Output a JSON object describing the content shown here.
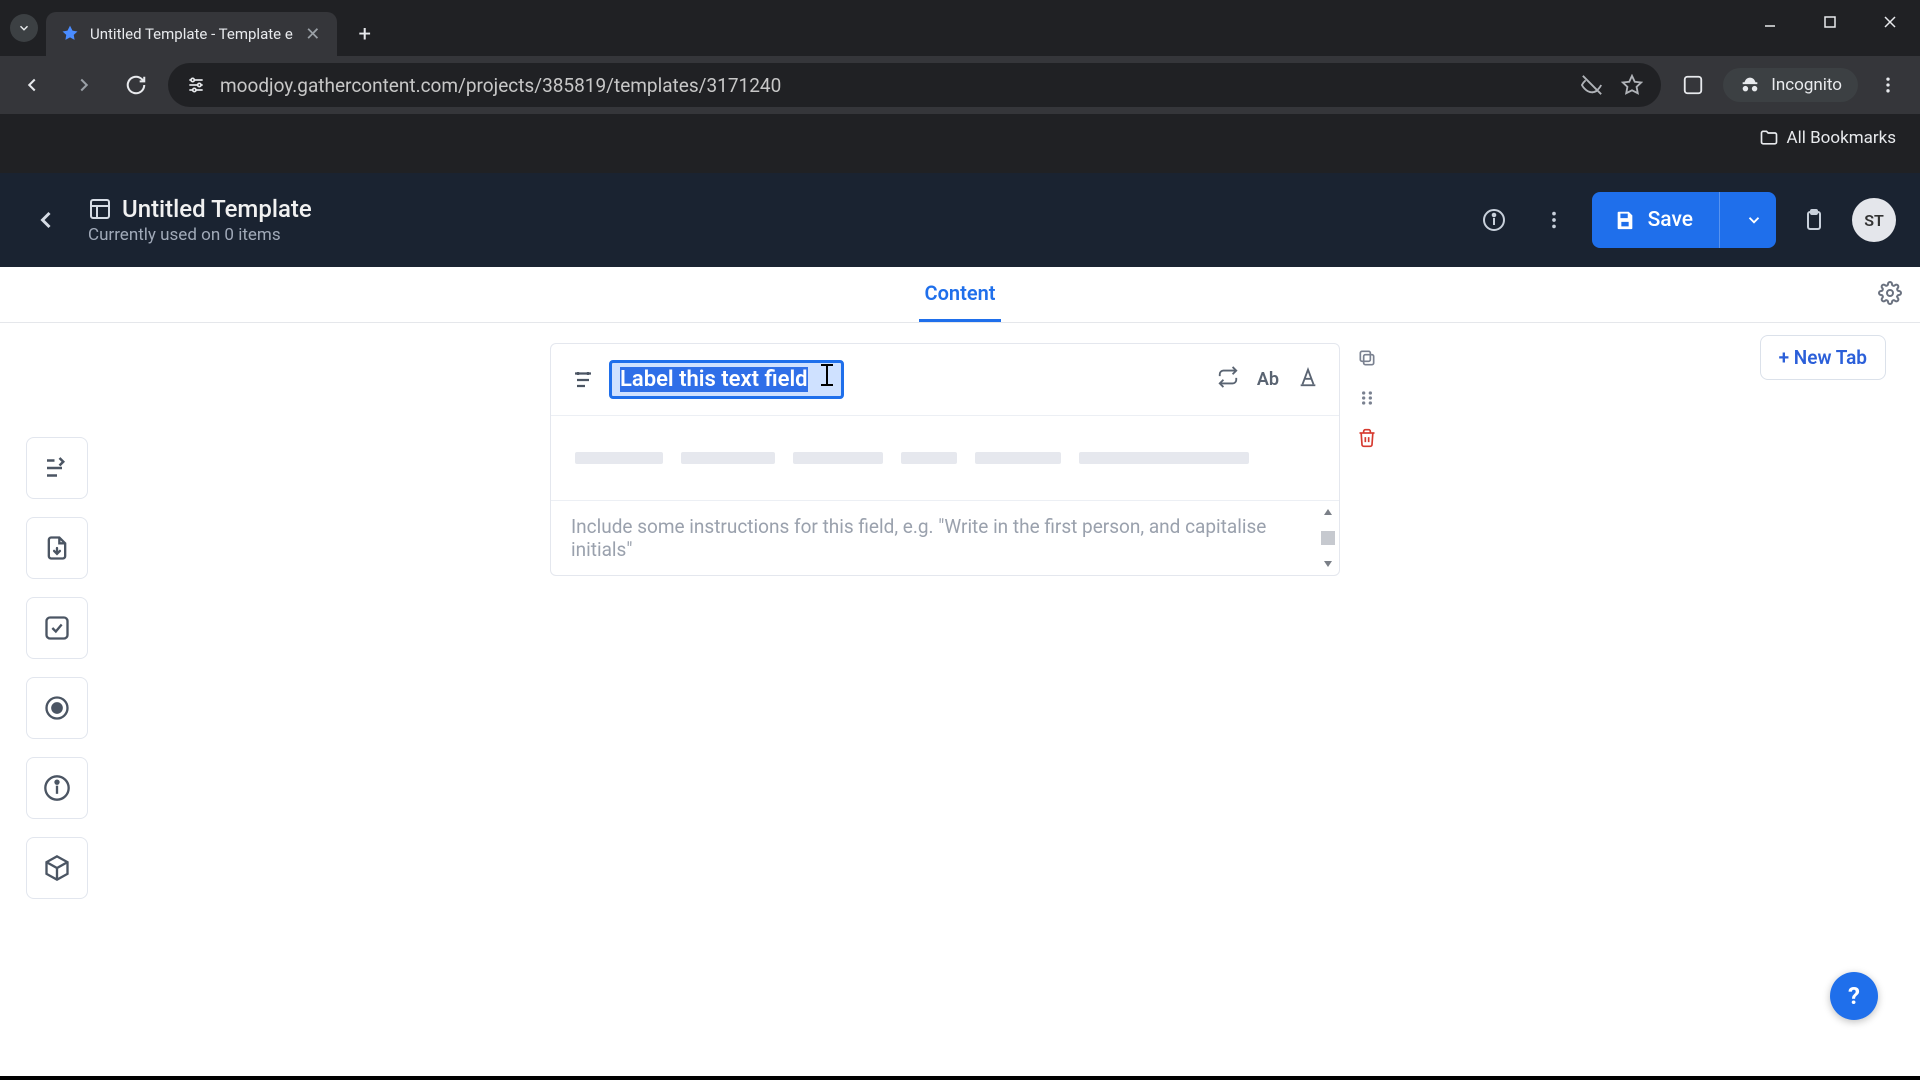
{
  "browser": {
    "tab_title": "Untitled Template - Template e",
    "url": "moodjoy.gathercontent.com/projects/385819/templates/3171240",
    "incognito_label": "Incognito",
    "all_bookmarks": "All Bookmarks"
  },
  "header": {
    "title": "Untitled Template",
    "subtitle": "Currently used on 0 items",
    "save_label": "Save",
    "avatar_initials": "ST"
  },
  "tabs": {
    "active": "Content",
    "new_tab_label": "+ New Tab"
  },
  "field_card": {
    "label_placeholder": "Label this text field",
    "tool_ab": "Ab",
    "instructions_placeholder": "Include some instructions for this field, e.g. \"Write in the first person, and capitalise initials\""
  },
  "help_label": "?"
}
